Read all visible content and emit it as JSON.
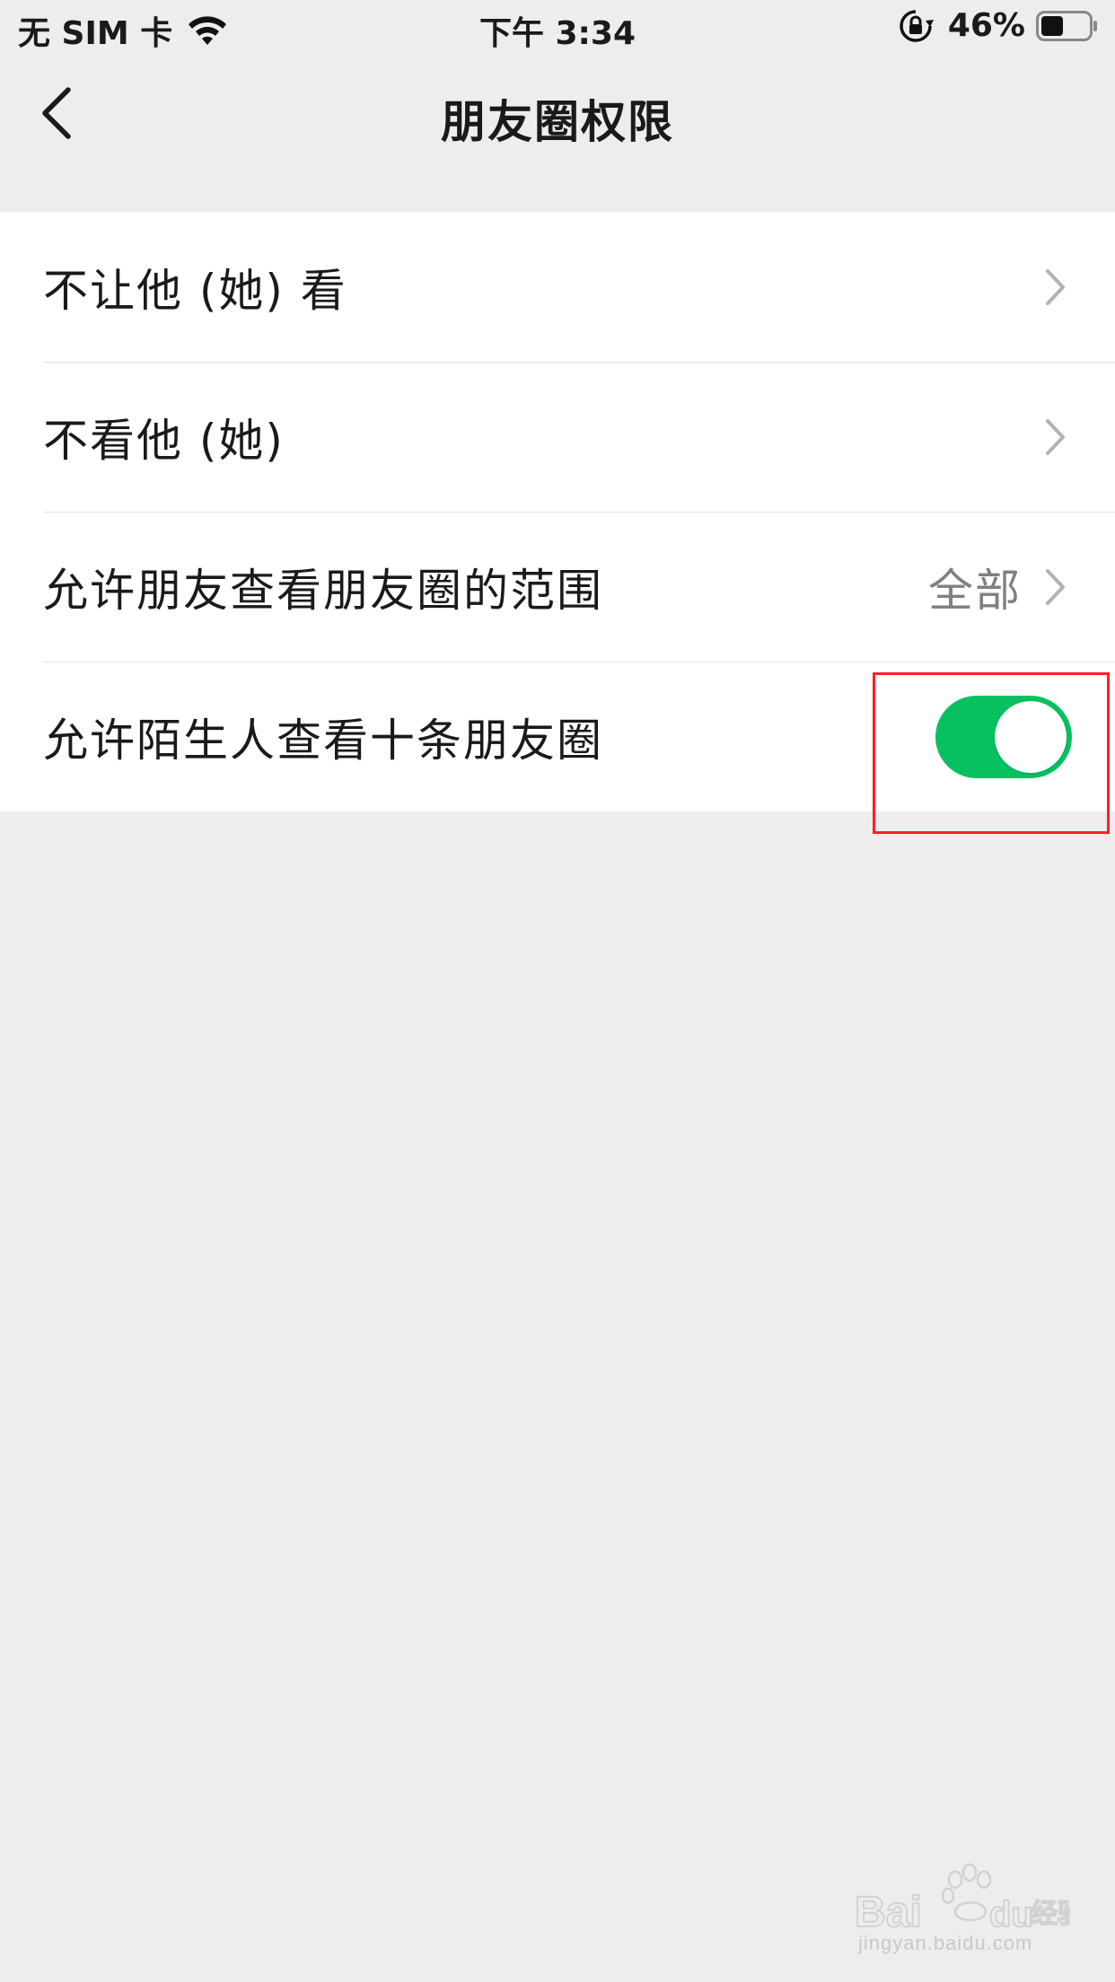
{
  "status_bar": {
    "carrier": "无 SIM 卡",
    "time": "下午 3:34",
    "battery": "46%"
  },
  "nav": {
    "title": "朋友圈权限"
  },
  "settings": {
    "rows": [
      {
        "label": "不让他 (她) 看"
      },
      {
        "label": "不看他 (她)"
      },
      {
        "label": "允许朋友查看朋友圈的范围",
        "value": "全部"
      },
      {
        "label": "允许陌生人查看十条朋友圈",
        "toggle_on": true
      }
    ]
  },
  "watermark": {
    "brand": "Baidu 经验",
    "url": "jingyan.baidu.com"
  },
  "colors": {
    "background": "#ededed",
    "toggle_on": "#07c160",
    "highlight": "#ff1e2a"
  }
}
